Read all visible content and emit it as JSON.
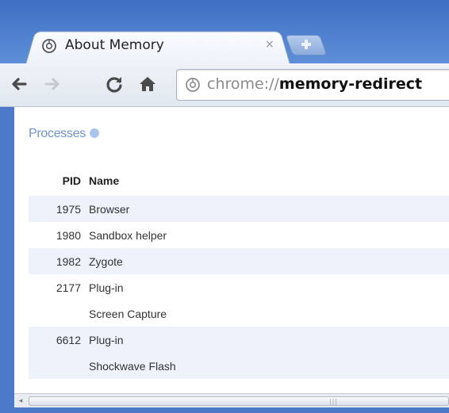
{
  "tab": {
    "title": "About Memory",
    "close": "×"
  },
  "omnibox": {
    "scheme": "chrome://",
    "host": "memory-redirect"
  },
  "page": {
    "heading": "Processes",
    "table": {
      "headers": {
        "pid": "PID",
        "name": "Name"
      },
      "rows": [
        {
          "pid": "1975",
          "name": "Browser",
          "sub": ""
        },
        {
          "pid": "1980",
          "name": "Sandbox helper",
          "sub": ""
        },
        {
          "pid": "1982",
          "name": "Zygote",
          "sub": ""
        },
        {
          "pid": "2177",
          "name": "Plug-in",
          "sub": "Screen Capture"
        },
        {
          "pid": "6612",
          "name": "Plug-in",
          "sub": "Shockwave Flash"
        }
      ]
    }
  },
  "icons": {
    "tab": "chrome-page-icon",
    "newtab": "new-tab-icon",
    "back": "back-arrow-icon",
    "forward": "forward-arrow-icon",
    "reload": "reload-icon",
    "home": "home-icon",
    "omnibox": "chrome-page-icon",
    "help": "help-icon",
    "scroll_left": "scroll-left-arrow-icon"
  },
  "colors": {
    "frame": "#4d79c9",
    "heading": "#6d93d0",
    "row_shade": "#edf2fb"
  }
}
